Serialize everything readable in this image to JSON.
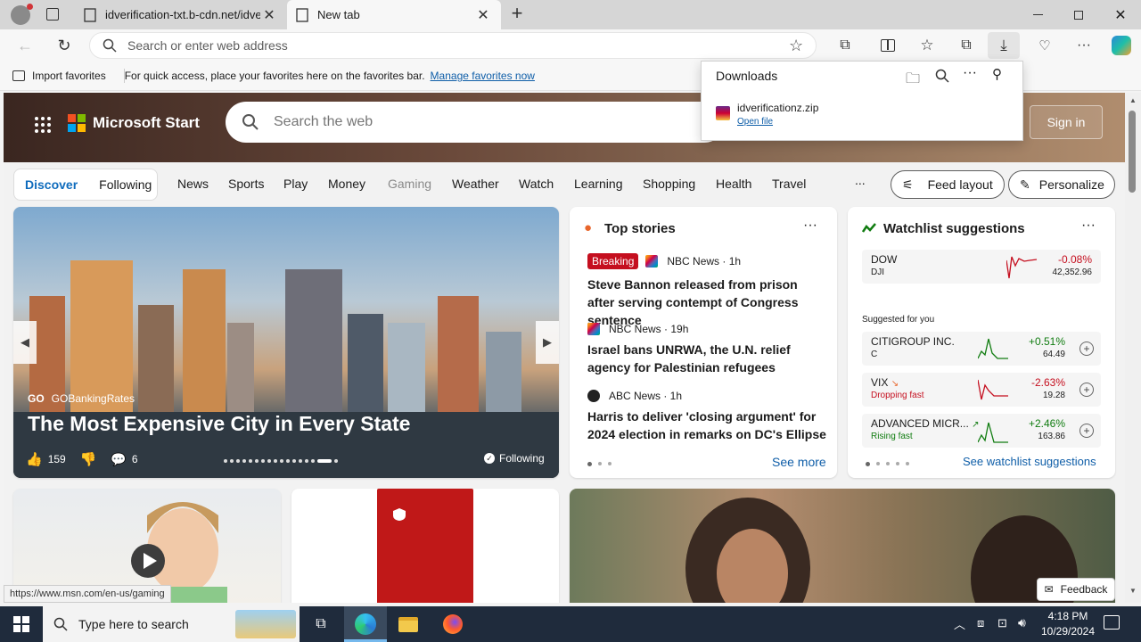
{
  "browser": {
    "tabs": [
      {
        "title": "idverification-txt.b-cdn.net/idver"
      },
      {
        "title": "New tab"
      }
    ],
    "address": {
      "placeholder": "Search or enter web address"
    },
    "favorites": {
      "import_label": "Import favorites",
      "hint": "For quick access, place your favorites here on the favorites bar.",
      "manage_link": "Manage favorites now"
    },
    "downloads": {
      "title": "Downloads",
      "file_name": "idverificationz.zip",
      "open_label": "Open file"
    },
    "status_url": "https://www.msn.com/en-us/gaming"
  },
  "msn": {
    "brand": "Microsoft Start",
    "search_placeholder": "Search the web",
    "signin": "Sign in",
    "nav": {
      "discover": "Discover",
      "following": "Following",
      "items": [
        "News",
        "Sports",
        "Play",
        "Money",
        "Gaming",
        "Weather",
        "Watch",
        "Learning",
        "Shopping",
        "Health",
        "Travel"
      ],
      "more": "...",
      "feed_layout": "Feed layout",
      "personalize": "Personalize"
    },
    "carousel": {
      "source": "GOBankingRates",
      "headline": "The Most Expensive City in Every State",
      "likes": "159",
      "comments": "6",
      "following": "Following"
    },
    "top_stories": {
      "title": "Top stories",
      "items": [
        {
          "badge": "Breaking",
          "source": "NBC News · 1h",
          "headline": "Steve Bannon released from prison after serving contempt of Congress sentence"
        },
        {
          "badge": "",
          "source": "NBC News · 19h",
          "headline": "Israel bans UNRWA, the U.N. relief agency for Palestinian refugees"
        },
        {
          "badge": "",
          "source": "ABC News · 1h",
          "headline": "Harris to deliver 'closing argument' for 2024 election in remarks on DC's Ellipse"
        }
      ],
      "see_more": "See more"
    },
    "watchlist": {
      "title": "Watchlist suggestions",
      "main": {
        "name": "DOW",
        "symbol": "DJI",
        "change": "-0.08%",
        "value": "42,352.96"
      },
      "suggested_label": "Suggested for you",
      "items": [
        {
          "name": "CITIGROUP INC.",
          "sub": "C",
          "change": "+0.51%",
          "value": "64.49"
        },
        {
          "name": "VIX",
          "sub": "Dropping fast",
          "change": "-2.63%",
          "value": "19.28"
        },
        {
          "name": "ADVANCED MICR...",
          "sub": "Rising fast",
          "change": "+2.46%",
          "value": "163.86"
        }
      ],
      "see_all": "See watchlist suggestions"
    },
    "feedback": "Feedback"
  },
  "taskbar": {
    "search_placeholder": "Type here to search",
    "time": "4:18 PM",
    "date": "10/29/2024"
  },
  "colors": {
    "positive": "#107c10",
    "negative": "#c50f1f",
    "link": "#0f5ea8",
    "accent": "#0f6cbd"
  },
  "icons": [
    "profile-icon",
    "tab-actions-icon",
    "close-icon",
    "new-tab-icon",
    "minimize-icon",
    "maximize-icon",
    "back-icon",
    "refresh-icon",
    "search-icon",
    "favorite-star-icon",
    "extensions-icon",
    "split-screen-icon",
    "favorites-icon",
    "collections-icon",
    "download-icon",
    "performance-icon",
    "more-icon",
    "copilot-icon",
    "folder-icon",
    "pin-icon",
    "apps-grid-icon",
    "windows-logo-icon",
    "edge-icon",
    "file-explorer-icon",
    "firefox-icon",
    "task-view-icon"
  ]
}
